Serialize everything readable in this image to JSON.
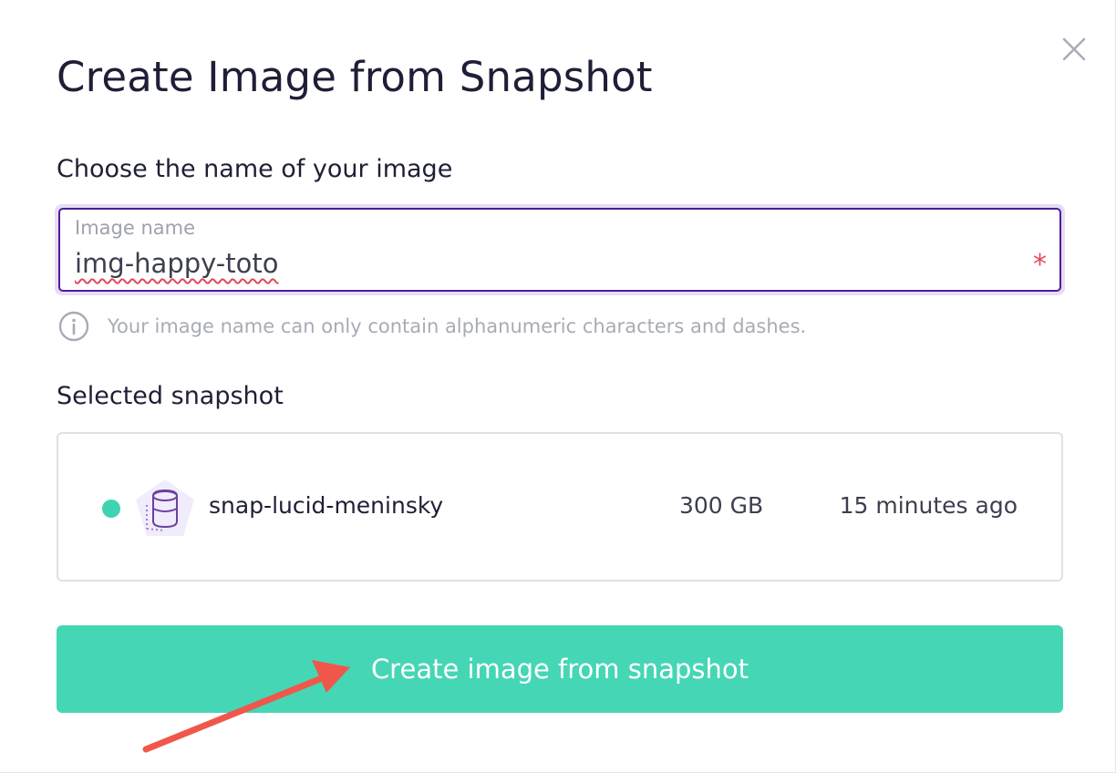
{
  "modal": {
    "title": "Create Image from Snapshot",
    "close_icon": "close-icon"
  },
  "name_section": {
    "label": "Choose the name of your image",
    "input": {
      "placeholder": "Image name",
      "value": "img-happy-toto",
      "required_mark": "*"
    },
    "helper": {
      "icon": "info-icon",
      "text": "Your image name can only contain alphanumeric characters and dashes."
    }
  },
  "snapshot_section": {
    "label": "Selected snapshot",
    "snapshot": {
      "status_color": "#3ED3B1",
      "icon": "volume-icon",
      "name": "snap-lucid-meninsky",
      "size": "300 GB",
      "created": "15 minutes ago"
    }
  },
  "actions": {
    "primary_label": "Create image from snapshot",
    "primary_color": "#45D6B5"
  },
  "colors": {
    "title_text": "#1E1F36",
    "input_border": "#4C1D95",
    "input_focus_ring": "#E7DCF5",
    "required": "#E0495B",
    "annotation_arrow": "#F0574A"
  }
}
